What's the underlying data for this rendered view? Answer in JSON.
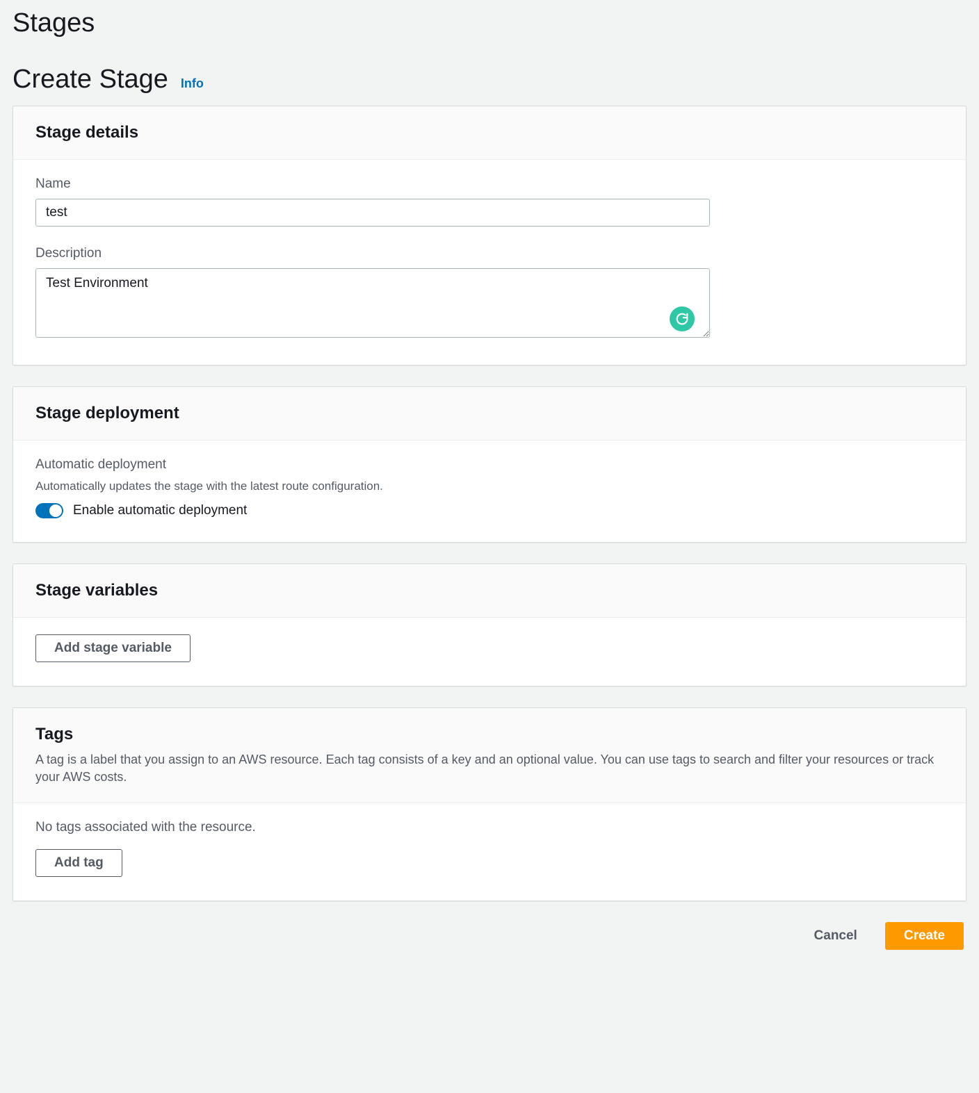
{
  "breadcrumb": "Stages",
  "page": {
    "title": "Create Stage",
    "info": "Info"
  },
  "details": {
    "header": "Stage details",
    "name_label": "Name",
    "name_value": "test",
    "desc_label": "Description",
    "desc_value": "Test Environment"
  },
  "deployment": {
    "header": "Stage deployment",
    "auto_label": "Automatic deployment",
    "auto_desc": "Automatically updates the stage with the latest route configuration.",
    "toggle_label": "Enable automatic deployment",
    "toggle_on": true
  },
  "variables": {
    "header": "Stage variables",
    "add_btn": "Add stage variable"
  },
  "tags": {
    "header": "Tags",
    "desc": "A tag is a label that you assign to an AWS resource. Each tag consists of a key and an optional value. You can use tags to search and filter your resources or track your AWS costs.",
    "empty": "No tags associated with the resource.",
    "add_btn": "Add tag"
  },
  "footer": {
    "cancel": "Cancel",
    "create": "Create"
  }
}
